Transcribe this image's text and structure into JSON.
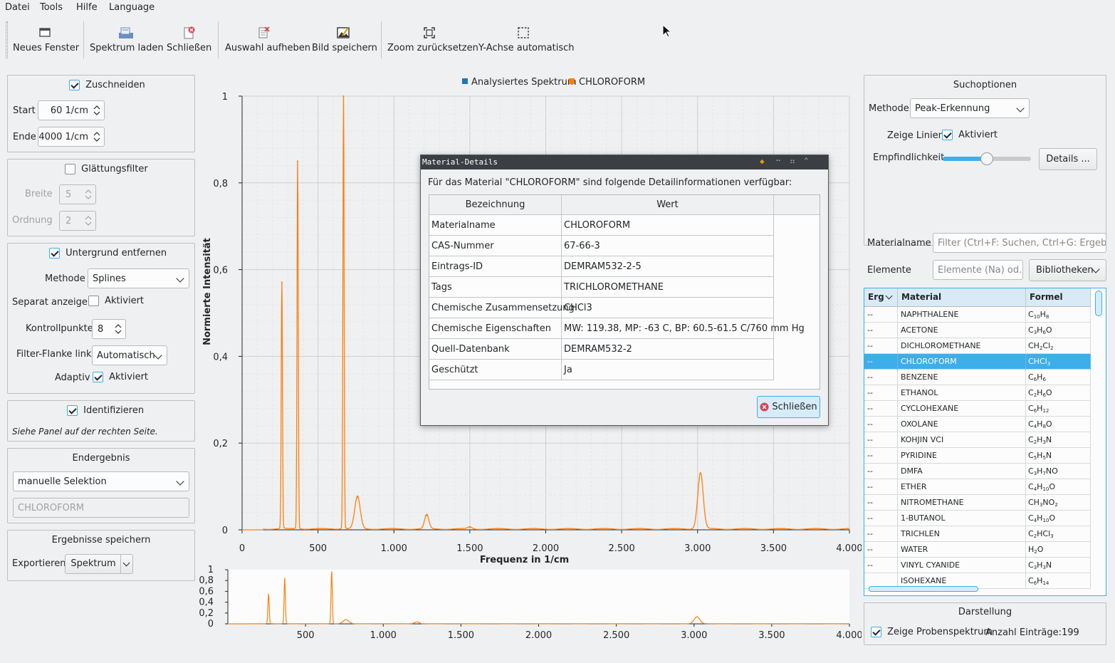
{
  "menu": {
    "items": [
      "Datei",
      "Tools",
      "Hilfe",
      "Language"
    ]
  },
  "toolbar": {
    "new_window": "Neues Fenster",
    "load_spectrum": "Spektrum laden",
    "close": "Schließen",
    "clear_selection": "Auswahl aufheben",
    "save_image": "Bild speichern",
    "reset_zoom": "Zoom zurücksetzen",
    "auto_y": "Y-Achse automatisch"
  },
  "left": {
    "crop": {
      "label": "Zuschneiden",
      "checked": true,
      "start_label": "Start",
      "start_value": "60 1/cm",
      "end_label": "Ende",
      "end_value": "4000 1/cm"
    },
    "smoothing": {
      "label": "Glättungsfilter",
      "checked": false,
      "width_label": "Breite",
      "width_value": "5",
      "order_label": "Ordnung",
      "order_value": "2"
    },
    "background": {
      "label": "Untergrund entfernen",
      "checked": true,
      "method_label": "Methode",
      "method_value": "Splines",
      "separate_label": "Separat anzeigen",
      "separate_check": "Aktiviert",
      "control_label": "Kontrollpunkte",
      "control_value": "8",
      "flank_label": "Filter-Flanke links",
      "flank_value": "Automatisch",
      "adaptive_label": "Adaptiv",
      "adaptive_check": "Aktiviert"
    },
    "identify": {
      "label": "Identifizieren",
      "checked": true,
      "hint": "Siehe Panel auf der rechten Seite."
    },
    "result": {
      "title": "Endergebnis",
      "mode": "manuelle Selektion",
      "value": "CHLOROFORM"
    },
    "save": {
      "title": "Ergebnisse speichern",
      "export_label": "Exportieren",
      "export_value": "Spektrum"
    }
  },
  "chart_data": [
    {
      "type": "line",
      "legend": [
        "Analysiertes Spektrum",
        "CHLOROFORM"
      ],
      "legend_colors": [
        "#1f77b4",
        "#ff7f0e"
      ],
      "legend_position": "top-center",
      "xlabel": "Frequenz in 1/cm",
      "ylabel": "Normierte Intensität",
      "xlim": [
        0,
        4000
      ],
      "ylim": [
        0,
        1
      ],
      "x_ticks": [
        "0",
        "500",
        "1.000",
        "1.500",
        "2.000",
        "2.500",
        "3.000",
        "3.500",
        "4.000"
      ],
      "y_ticks": [
        "0",
        "0,2",
        "0,4",
        "0,6",
        "0,8",
        "1"
      ],
      "grid": true,
      "series": [
        {
          "name": "CHLOROFORM",
          "color": "#ff7f0e",
          "peaks": [
            [
              262,
              0.57
            ],
            [
              366,
              0.85
            ],
            [
              668,
              1.0
            ],
            [
              760,
              0.075
            ],
            [
              1216,
              0.033
            ],
            [
              1500,
              0.005
            ],
            [
              3019,
              0.13
            ]
          ]
        }
      ]
    },
    {
      "type": "line",
      "xlim": [
        0,
        4000
      ],
      "ylim": [
        0,
        1
      ],
      "x_ticks": [
        "500",
        "1.000",
        "1.500",
        "2.000",
        "2.500",
        "3.000",
        "3.500",
        "4.000"
      ],
      "y_ticks": [
        "0",
        "0,2",
        "0,4",
        "0,6",
        "0,8",
        "1"
      ],
      "series": [
        {
          "name": "CHLOROFORM",
          "color": "#ff7f0e",
          "peaks": [
            [
              262,
              0.57
            ],
            [
              366,
              0.85
            ],
            [
              668,
              1.0
            ],
            [
              760,
              0.075
            ],
            [
              1216,
              0.033
            ],
            [
              3019,
              0.13
            ]
          ]
        }
      ]
    }
  ],
  "dialog": {
    "title": "Material-Details",
    "intro": "Für das Material \"CHLOROFORM\" sind folgende Detailinformationen verfügbar:",
    "col1": "Bezeichnung",
    "col2": "Wert",
    "rows": [
      {
        "k": "Materialname",
        "v": "CHLOROFORM"
      },
      {
        "k": "CAS-Nummer",
        "v": "67-66-3"
      },
      {
        "k": "Eintrags-ID",
        "v": "DEMRAM532-2-5"
      },
      {
        "k": "Tags",
        "v": "TRICHLOROMETHANE"
      },
      {
        "k": "Chemische Zusammensetzung",
        "v": "CHCl3"
      },
      {
        "k": "Chemische Eigenschaften",
        "v": "MW: 119.38, MP: -63 C, BP: 60.5-61.5 C/760 mm Hg"
      },
      {
        "k": "Quell-Datenbank",
        "v": "DEMRAM532-2"
      },
      {
        "k": "Geschützt",
        "v": "Ja"
      }
    ],
    "close_label": "Schließen"
  },
  "right": {
    "search": {
      "title": "Suchoptionen",
      "method_label": "Methode",
      "method_value": "Peak-Erkennung",
      "lines_label": "Zeige Linien",
      "lines_check": "Aktiviert",
      "sensitivity_label": "Empfindlichkeit",
      "sensitivity_value": 0.5,
      "details_button": "Details ..."
    },
    "material_label": "Materialname",
    "material_placeholder": "Filter (Ctrl+F: Suchen, Ctrl+G: Ergebnis)",
    "elements_label": "Elemente",
    "elements_placeholder": "Elemente (Na) od...",
    "libraries": "Bibliotheken",
    "table": {
      "headers": [
        "Erg",
        "Material",
        "Formel"
      ],
      "rows": [
        {
          "erg": "--",
          "name": "NAPHTHALENE",
          "f": [
            [
              "C",
              ""
            ],
            [
              "10",
              "s"
            ],
            [
              "H",
              ""
            ],
            [
              "8",
              "s"
            ]
          ]
        },
        {
          "erg": "--",
          "name": "ACETONE",
          "f": [
            [
              "C",
              ""
            ],
            [
              "3",
              "s"
            ],
            [
              "H",
              ""
            ],
            [
              "6",
              "s"
            ],
            [
              "O",
              ""
            ]
          ]
        },
        {
          "erg": "--",
          "name": "DICHLOROMETHANE",
          "f": [
            [
              "CH",
              ""
            ],
            [
              "2",
              "s"
            ],
            [
              "Cl",
              ""
            ],
            [
              "2",
              "s"
            ]
          ]
        },
        {
          "erg": "--",
          "name": "CHLOROFORM",
          "f": [
            [
              "CHCl",
              ""
            ],
            [
              "3",
              "s"
            ]
          ],
          "selected": true
        },
        {
          "erg": "--",
          "name": "BENZENE",
          "f": [
            [
              "C",
              ""
            ],
            [
              "6",
              "s"
            ],
            [
              "H",
              ""
            ],
            [
              "6",
              "s"
            ]
          ]
        },
        {
          "erg": "--",
          "name": "ETHANOL",
          "f": [
            [
              "C",
              ""
            ],
            [
              "2",
              "s"
            ],
            [
              "H",
              ""
            ],
            [
              "6",
              "s"
            ],
            [
              "O",
              ""
            ]
          ]
        },
        {
          "erg": "--",
          "name": "CYCLOHEXANE",
          "f": [
            [
              "C",
              ""
            ],
            [
              "6",
              "s"
            ],
            [
              "H",
              ""
            ],
            [
              "12",
              "s"
            ]
          ]
        },
        {
          "erg": "--",
          "name": "OXOLANE",
          "f": [
            [
              "C",
              ""
            ],
            [
              "4",
              "s"
            ],
            [
              "H",
              ""
            ],
            [
              "8",
              "s"
            ],
            [
              "O",
              ""
            ]
          ]
        },
        {
          "erg": "--",
          "name": "KOHJIN VCI",
          "f": [
            [
              "C",
              ""
            ],
            [
              "2",
              "s"
            ],
            [
              "H",
              ""
            ],
            [
              "3",
              "s"
            ],
            [
              "N",
              ""
            ]
          ]
        },
        {
          "erg": "--",
          "name": "PYRIDINE",
          "f": [
            [
              "C",
              ""
            ],
            [
              "5",
              "s"
            ],
            [
              "H",
              ""
            ],
            [
              "5",
              "s"
            ],
            [
              "N",
              ""
            ]
          ]
        },
        {
          "erg": "--",
          "name": "DMFA",
          "f": [
            [
              "C",
              ""
            ],
            [
              "3",
              "s"
            ],
            [
              "H",
              ""
            ],
            [
              "7",
              "s"
            ],
            [
              "NO",
              ""
            ]
          ]
        },
        {
          "erg": "--",
          "name": "ETHER",
          "f": [
            [
              "C",
              ""
            ],
            [
              "4",
              "s"
            ],
            [
              "H",
              ""
            ],
            [
              "10",
              "s"
            ],
            [
              "O",
              ""
            ]
          ]
        },
        {
          "erg": "--",
          "name": "NITROMETHANE",
          "f": [
            [
              "CH",
              ""
            ],
            [
              "3",
              "s"
            ],
            [
              "NO",
              ""
            ],
            [
              "2",
              "s"
            ]
          ]
        },
        {
          "erg": "--",
          "name": "1-BUTANOL",
          "f": [
            [
              "C",
              ""
            ],
            [
              "4",
              "s"
            ],
            [
              "H",
              ""
            ],
            [
              "10",
              "s"
            ],
            [
              "O",
              ""
            ]
          ]
        },
        {
          "erg": "--",
          "name": "TRICHLEN",
          "f": [
            [
              "C",
              ""
            ],
            [
              "2",
              "s"
            ],
            [
              "HCl",
              ""
            ],
            [
              "3",
              "s"
            ]
          ]
        },
        {
          "erg": "--",
          "name": "WATER",
          "f": [
            [
              "H",
              ""
            ],
            [
              "2",
              "s"
            ],
            [
              "O",
              ""
            ]
          ]
        },
        {
          "erg": "--",
          "name": "VINYL CYANIDE",
          "f": [
            [
              "C",
              ""
            ],
            [
              "3",
              "s"
            ],
            [
              "H",
              ""
            ],
            [
              "3",
              "s"
            ],
            [
              "N",
              ""
            ]
          ]
        },
        {
          "erg": "",
          "name": "ISOHEXANE",
          "f": [
            [
              "C",
              ""
            ],
            [
              "6",
              "s"
            ],
            [
              "H",
              ""
            ],
            [
              "14",
              "s"
            ]
          ]
        }
      ]
    },
    "display": {
      "title": "Darstellung",
      "probe_label": "Zeige Probenspektrum",
      "count_label": "Anzahl Einträge:",
      "count": "199"
    }
  }
}
